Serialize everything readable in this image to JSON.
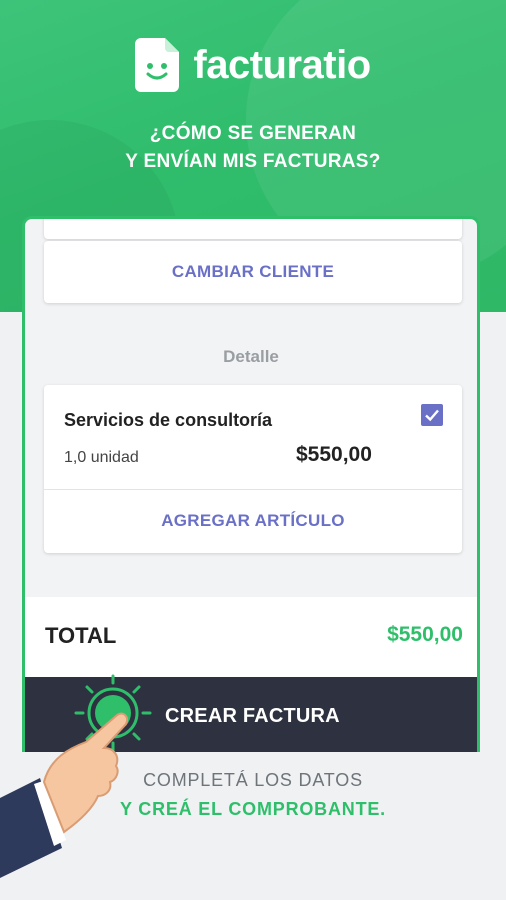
{
  "brand": {
    "name": "facturatio",
    "accent": "#2fbf6b",
    "icon": "smiling-document-icon"
  },
  "headline": {
    "line1": "¿CÓMO SE GENERAN",
    "line2": "Y ENVÍAN MIS FACTURAS?"
  },
  "client": {
    "change_label": "CAMBIAR CLIENTE"
  },
  "detail": {
    "section_label": "Detalle",
    "item": {
      "name": "Servicios de consultoría",
      "quantity": "1,0 unidad",
      "price": "$550,00",
      "checked": true
    },
    "add_label": "AGREGAR ARTÍCULO"
  },
  "total": {
    "label": "TOTAL",
    "value": "$550,00"
  },
  "create": {
    "label": "CREAR FACTURA"
  },
  "footer": {
    "line1": "COMPLETÁ LOS DATOS",
    "line2": "Y CREÁ EL COMPROBANTE."
  },
  "colors": {
    "link": "#6a70c6",
    "dark_bar": "#2e3140",
    "background": "#eff1f3"
  }
}
